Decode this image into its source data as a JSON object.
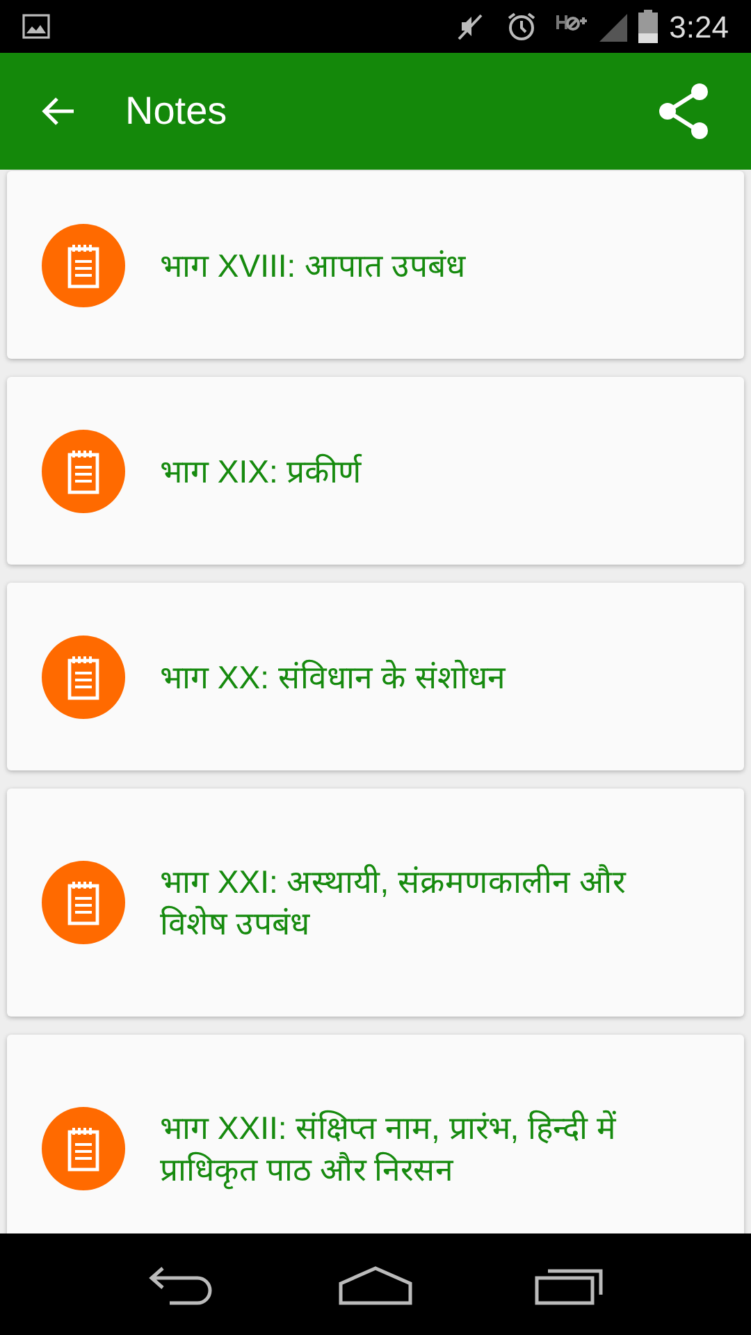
{
  "status_bar": {
    "time": "3:24"
  },
  "app_bar": {
    "title": "Notes"
  },
  "notes": [
    {
      "title": "भाग XVIII: आपात उपबंध"
    },
    {
      "title": "भाग XIX: प्रकीर्ण"
    },
    {
      "title": "भाग XX: संविधान के संशोधन"
    },
    {
      "title": "भाग XXI: अस्थायी, संक्रमणकालीन और विशेष उपबंध"
    },
    {
      "title": "भाग XXII: संक्षिप्त नाम, प्रारंभ, हिन्दी में प्राधिकृत पाठ और निरसन"
    }
  ]
}
